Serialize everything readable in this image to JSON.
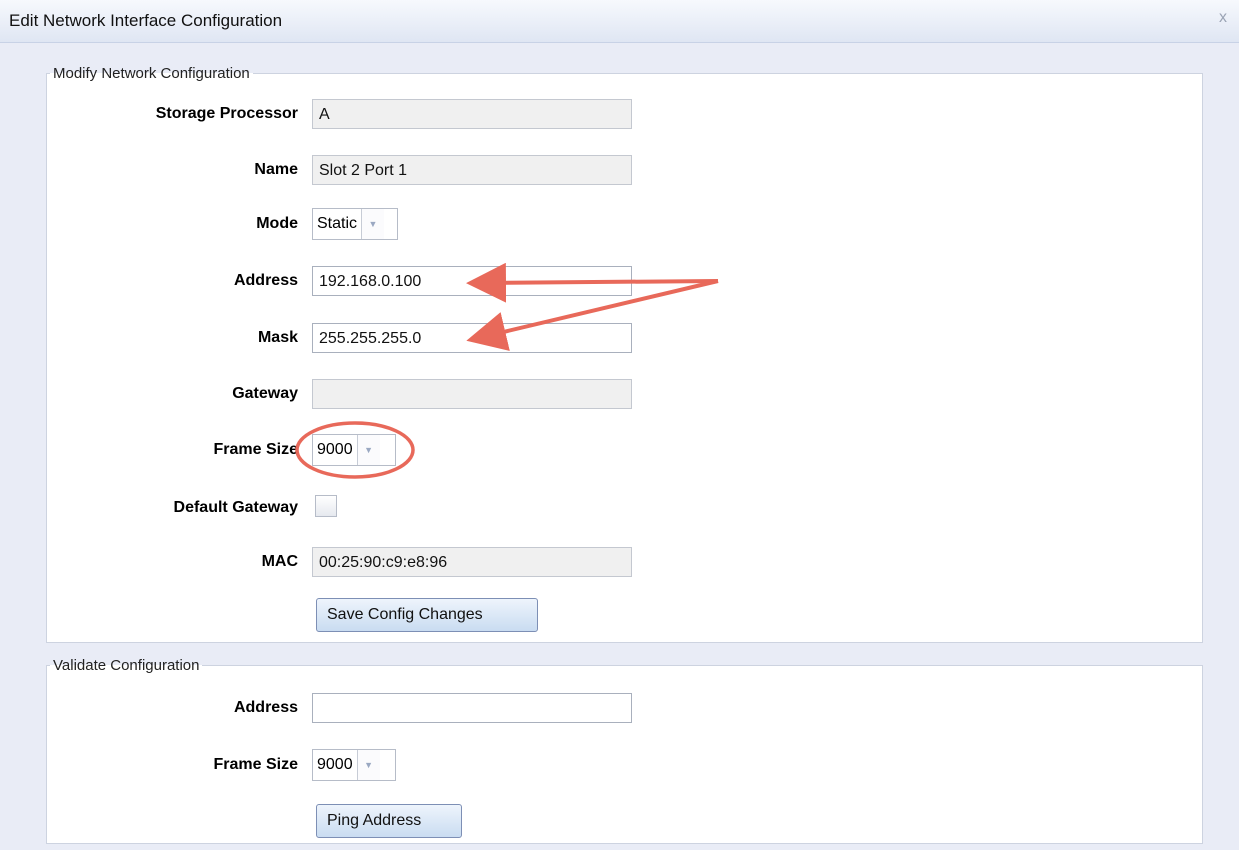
{
  "dialog": {
    "title": "Edit Network Interface Configuration",
    "close_icon": "x"
  },
  "modify": {
    "legend": "Modify Network Configuration",
    "storage_processor": {
      "label": "Storage Processor",
      "value": "A"
    },
    "name": {
      "label": "Name",
      "value": "Slot 2 Port 1"
    },
    "mode": {
      "label": "Mode",
      "value": "Static"
    },
    "address": {
      "label": "Address",
      "value": "192.168.0.100"
    },
    "mask": {
      "label": "Mask",
      "value": "255.255.255.0"
    },
    "gateway": {
      "label": "Gateway",
      "value": ""
    },
    "frame_size": {
      "label": "Frame Size",
      "value": "9000"
    },
    "default_gateway": {
      "label": "Default Gateway",
      "checked": false
    },
    "mac": {
      "label": "MAC",
      "value": "00:25:90:c9:e8:96"
    },
    "save_button": "Save Config Changes"
  },
  "validate": {
    "legend": "Validate Configuration",
    "address": {
      "label": "Address",
      "value": ""
    },
    "frame_size": {
      "label": "Frame Size",
      "value": "9000"
    },
    "ping_button": "Ping Address"
  },
  "annotations": {
    "color": "#e8695a",
    "arrows_target": [
      "address",
      "mask"
    ],
    "circle_target": "frame_size"
  }
}
